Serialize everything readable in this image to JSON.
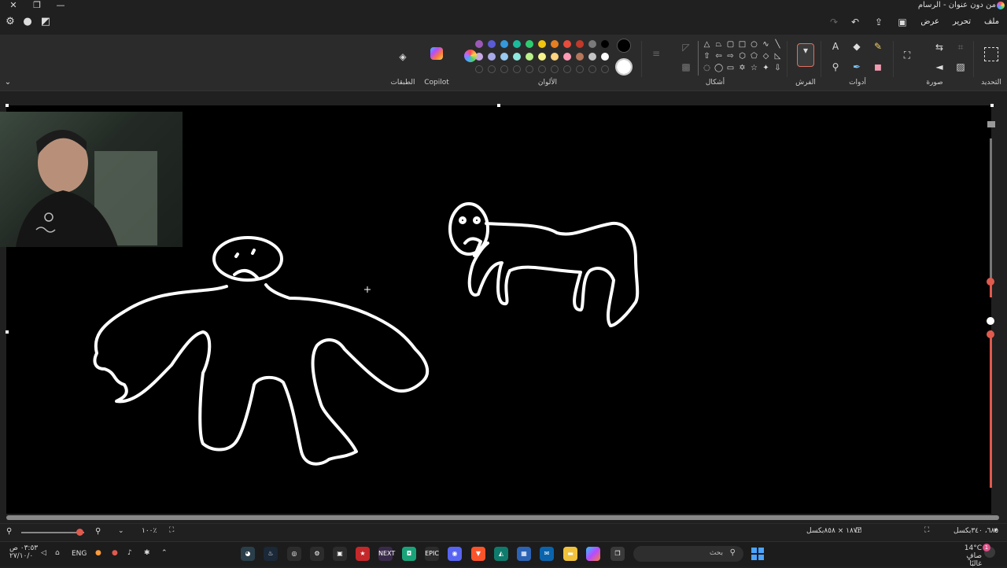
{
  "window": {
    "title": "من دون عنوان - الرسام",
    "close_glyph": "✕",
    "restore_glyph": "❐",
    "min_glyph": "—"
  },
  "menu": {
    "file": "ملف",
    "edit": "تحرير",
    "view": "عرض"
  },
  "ribbon": {
    "groups": {
      "selection": "التحديد",
      "image": "صورة",
      "tools": "أدوات",
      "brushes": "الفرش",
      "shapes": "أشكال",
      "colors": "الألوان",
      "copilot": "Copilot",
      "layers": "الطبقات"
    },
    "palette_top": [
      "#000000",
      "#7a7a7a",
      "#c0392b",
      "#e74c3c",
      "#e67e22",
      "#f1c40f",
      "#2ecc71",
      "#1abc9c",
      "#3498db",
      "#5b5bd6",
      "#9b59b6"
    ],
    "palette_mid": [
      "#ffffff",
      "#c3c3c3",
      "#b5765a",
      "#ff9ab5",
      "#ffd27f",
      "#f7f38a",
      "#b8f08a",
      "#8fe8e0",
      "#99c8f0",
      "#a9a9e8",
      "#c9a8e8"
    ],
    "primary_color": "#000000",
    "secondary_color": "#ffffff"
  },
  "status": {
    "cursor_pos": "٦٨٥، ٣٤٠بكسل",
    "canvas_size": "١٨٧٢ × ٨٥٨بكسل",
    "zoom": "١٠٠٪"
  },
  "taskbar": {
    "search_placeholder": "بحث",
    "lang": "ENG",
    "time": "٠٣:٥٣ ص",
    "date": "٢٧/١٠/٠",
    "weather_temp": "14°C",
    "weather_desc": "صافٍ غالبًا",
    "notif_count": "1",
    "icons": [
      "EPIC",
      "NEXT"
    ]
  }
}
